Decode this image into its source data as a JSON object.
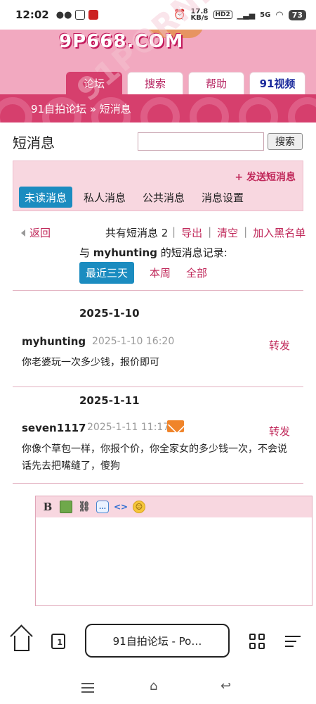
{
  "status_bar": {
    "time": "12:02",
    "net_speed": "17.8\nKB/s",
    "hd_badge": "HD2",
    "signal": "5G",
    "battery": "73"
  },
  "header": {
    "logo": "9P668.COM",
    "tabs": [
      {
        "label": "论坛",
        "active": true
      },
      {
        "label": "搜索",
        "active": false
      },
      {
        "label": "帮助",
        "active": false
      },
      {
        "label": "91视频",
        "active": false
      }
    ],
    "breadcrumb": "91自拍论坛 » 短消息",
    "watermark": "91PORN.COM"
  },
  "page": {
    "title": "短消息",
    "search_placeholder": "",
    "search_button": "搜索"
  },
  "messages_panel": {
    "send_link": "+ 发送短消息",
    "tabs": [
      {
        "label": "未读消息",
        "active": true
      },
      {
        "label": "私人消息",
        "active": false
      },
      {
        "label": "公共消息",
        "active": false
      },
      {
        "label": "消息设置",
        "active": false
      }
    ]
  },
  "toolbar": {
    "back": "返回",
    "count_text": "共有短消息 2",
    "actions": [
      "导出",
      "清空",
      "加入黑名单"
    ]
  },
  "history": {
    "prefix": "与",
    "username": "myhunting",
    "suffix": "的短消息记录:",
    "ranges": [
      {
        "label": "最近三天",
        "active": true
      },
      {
        "label": "本周",
        "active": false
      },
      {
        "label": "全部",
        "active": false
      }
    ]
  },
  "message_groups": [
    {
      "date": "2025-1-10",
      "sender": "myhunting",
      "timestamp": "2025-1-10 16:20",
      "forward": "转发",
      "text": "你老婆玩一次多少钱，报价即可"
    },
    {
      "date": "2025-1-11",
      "sender": "seven1117",
      "timestamp": "2025-1-11 11:17",
      "forward": "转发",
      "text": "你像个草包一样，你报个价，你全家女的多少钱一次，不会说话先去把嘴缝了，傻狗"
    }
  ],
  "editor": {
    "toolbar_icons": [
      "bold-icon",
      "image-icon",
      "link-icon",
      "quote-icon",
      "code-icon",
      "smiley-icon"
    ],
    "bold_glyph": "B",
    "code_glyph": "<>"
  },
  "browser_bar": {
    "url_title": "91自拍论坛 - Po…",
    "tab_count": "1"
  }
}
